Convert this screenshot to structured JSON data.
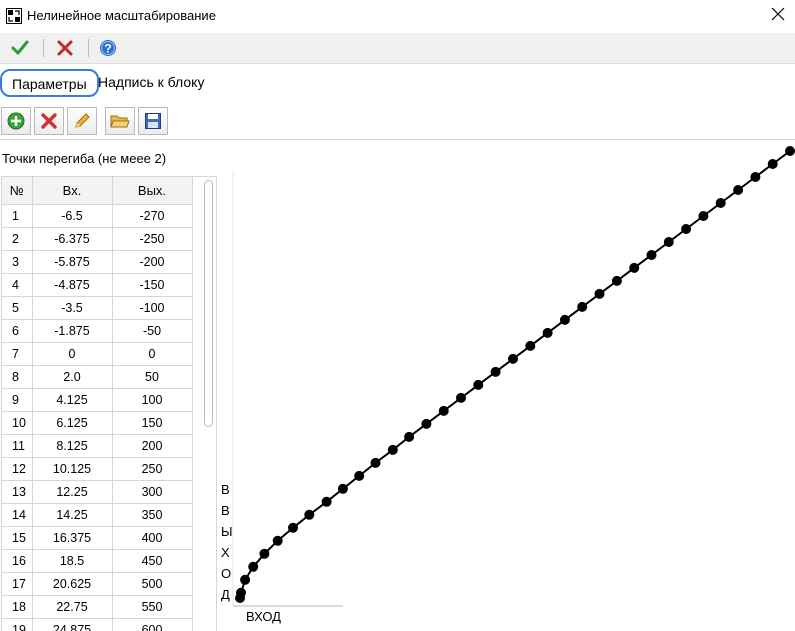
{
  "window": {
    "title": "Нелинейное масштабирование"
  },
  "toolbar": {
    "ok_icon": "checkmark-icon",
    "cancel_icon": "red-x-icon",
    "help_icon": "help-icon"
  },
  "tabs": [
    {
      "label": "Параметры",
      "active": true
    },
    {
      "label": "Надпись к блоку",
      "active": false
    }
  ],
  "points_toolbar": {
    "icons": [
      "add-point-icon",
      "delete-point-icon",
      "edit-pencil-icon",
      "open-folder-icon",
      "save-disk-icon"
    ]
  },
  "points_label": "Точки перегиба (не меее 2)",
  "table": {
    "headers": [
      "№",
      "Вх.",
      "Вых."
    ],
    "rows": [
      [
        "1",
        "-6.5",
        "-270"
      ],
      [
        "2",
        "-6.375",
        "-250"
      ],
      [
        "3",
        "-5.875",
        "-200"
      ],
      [
        "4",
        "-4.875",
        "-150"
      ],
      [
        "5",
        "-3.5",
        "-100"
      ],
      [
        "6",
        "-1.875",
        "-50"
      ],
      [
        "7",
        "0",
        "0"
      ],
      [
        "8",
        "2.0",
        "50"
      ],
      [
        "9",
        "4.125",
        "100"
      ],
      [
        "10",
        "6.125",
        "150"
      ],
      [
        "11",
        "8.125",
        "200"
      ],
      [
        "12",
        "10.125",
        "250"
      ],
      [
        "13",
        "12.25",
        "300"
      ],
      [
        "14",
        "14.25",
        "350"
      ],
      [
        "15",
        "16.375",
        "400"
      ],
      [
        "16",
        "18.5",
        "450"
      ],
      [
        "17",
        "20.625",
        "500"
      ],
      [
        "18",
        "22.75",
        "550"
      ],
      [
        "19",
        "24.875",
        "600"
      ]
    ],
    "scroll_position": 0
  },
  "chart_data": {
    "type": "line",
    "xlabel": "ВХОД",
    "ylabel_letters": [
      "В",
      "В",
      "Ы",
      "Х",
      "О",
      "Д"
    ],
    "ylabel": "ВЫХОД",
    "x": [
      -6.5,
      -6.375,
      -5.875,
      -4.875,
      -3.5,
      -1.875,
      0,
      2.0,
      4.125,
      6.125,
      8.125,
      10.125,
      12.25,
      14.25,
      16.375,
      18.5,
      20.625,
      22.75,
      24.875,
      27.0,
      29.125,
      31.25,
      33.375,
      35.5,
      37.625,
      39.75,
      41.875,
      44.0,
      46.125,
      48.25,
      50.375,
      52.5,
      54.625,
      56.75,
      58.875,
      61.0
    ],
    "y": [
      -270,
      -250,
      -200,
      -150,
      -100,
      -50,
      0,
      50,
      100,
      150,
      200,
      250,
      300,
      350,
      400,
      450,
      500,
      550,
      600,
      650,
      700,
      750,
      800,
      850,
      900,
      950,
      1000,
      1050,
      1100,
      1150,
      1200,
      1250,
      1300,
      1350,
      1400,
      1450
    ],
    "marker": "circle",
    "line_color": "#000000",
    "marker_color": "#000000",
    "grid": false
  }
}
